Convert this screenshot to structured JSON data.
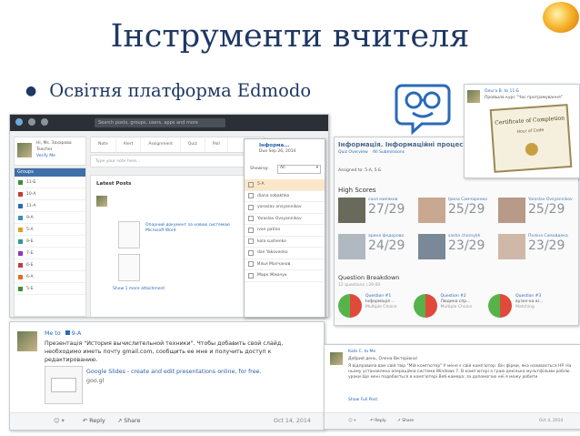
{
  "slide": {
    "title": "Інструменти вчителя",
    "bullet": "Освітня платформа Edmodo"
  },
  "dashboard": {
    "search_placeholder": "Search posts, groups, users, apps and more",
    "profile_name": "Hi, Ms. Захарова",
    "profile_role": "Teacher",
    "profile_link": "Verify Me",
    "groups_title": "Groups",
    "groups": [
      {
        "label": "11-Б",
        "color": "#3a8f3a"
      },
      {
        "label": "10-А",
        "color": "#c43b3b"
      },
      {
        "label": "11-А",
        "color": "#2a6ab8"
      },
      {
        "label": "9-А",
        "color": "#3a8fb8"
      },
      {
        "label": "5-А",
        "color": "#e0a020"
      },
      {
        "label": "9-Б",
        "color": "#2a9a9a"
      },
      {
        "label": "7-Б",
        "color": "#8a3ab8"
      },
      {
        "label": "6-Б",
        "color": "#c43b3b"
      },
      {
        "label": "6-А",
        "color": "#e07020"
      },
      {
        "label": "5-Б",
        "color": "#3a8f3a"
      }
    ],
    "tabs": [
      "Note",
      "Alert",
      "Assignment",
      "Quiz",
      "Poll"
    ],
    "post_placeholder": "Type your note here...",
    "latest_posts": "Latest Posts",
    "post_text": "Опорний документ за новою системою Microsoft Word",
    "show_more": "Show 1 more attachment"
  },
  "popup": {
    "title": "Інформа...",
    "due": "Due Sep 26, 2014",
    "showing_label": "Showing:",
    "showing_value": "All",
    "rows": [
      "5-А",
      "diana sobakhko",
      "yaroslav onsyannikov",
      "Yaroslav Ovsyannikov",
      "ivan patino",
      "kola sushenko",
      "dan Yakovenko",
      "Илья Молчанов",
      "Марк Жмачук"
    ]
  },
  "quiz": {
    "title": "Інформація. Інформаційні процеси.",
    "tabs": [
      "Quiz Overview",
      "All Submissions"
    ],
    "assigned": "Assigned to: 5-А, 5-Б",
    "high_scores": "High Scores",
    "scores": [
      {
        "name": "соня миляков",
        "score": "27/29"
      },
      {
        "name": "Ірина Самчаренко",
        "score": "25/29"
      },
      {
        "name": "Yaroslav Ovsyannikov",
        "score": "25/29"
      },
      {
        "name": "арина федорова",
        "score": "24/29"
      },
      {
        "name": "sasha chornykh",
        "score": "23/29"
      },
      {
        "name": "Поліна Самойдека",
        "score": "23/29"
      }
    ],
    "breakdown_title": "Question Breakdown",
    "breakdown_sub": "12 questions | 29.00",
    "questions": [
      {
        "label": "Question #1",
        "text": "Інформація ...",
        "type": "Multiple Choice"
      },
      {
        "label": "Question #2",
        "text": "Людина спр...",
        "type": "Multiple Choice"
      },
      {
        "label": "Question #3",
        "text": "вузол-ка ві...",
        "type": "Matching"
      }
    ]
  },
  "certificate": {
    "author": "Ольга В. to 11-Б",
    "text": "Пройшла курс \"Час програмування\"",
    "cert_title": "Certificate of Completion",
    "cert_sub": "Hour of Code"
  },
  "presentation_post": {
    "author": "Me to",
    "group": "9-А",
    "text": "Презентація \"История вычислительной техники\". Чтобы добавить свой слайд, необходимо иметь почту gmail.com, сообщить ее мне и получить доступ к редактированию.",
    "link_title": "Google Slides - create and edit presentations online, for free.",
    "link_url": "goo.gl",
    "reply": "Reply",
    "share": "Share",
    "date": "Oct 14, 2014"
  },
  "comment_post": {
    "author": "Kate C. to Me",
    "greeting": "Добрий день, Олена Вікторівна!",
    "text": "Я відправила вам свій твір \"Мій комп'ютер\" У мене є свій комп'ютер. Він фірми, яка називається HP. На ньому установлена операційна система Windows 7. В комп'ютері я граю декілька мультфільми роблю уроки Ще мені подобається в комп'ютері Веб-камера: за допомогою неї я можу робити",
    "show_full": "Show Full Post",
    "reply": "Reply",
    "share": "Share",
    "date": "Oct 4, 2014"
  }
}
